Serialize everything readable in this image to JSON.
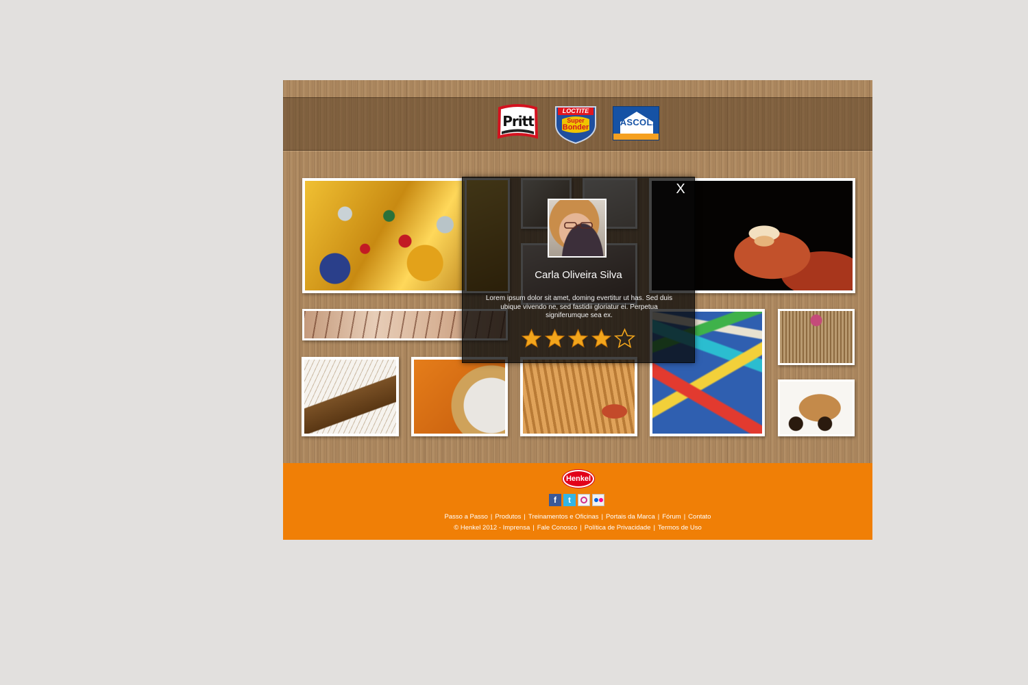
{
  "brands": {
    "pritt": "Pritt",
    "loctite_top": "LOCTITE",
    "loctite_bottom_1": "Super",
    "loctite_bottom_2": "Bonder",
    "cascola": "CASCOLA"
  },
  "gallery": {
    "tiles": [
      "ornament",
      "hand-house",
      "wood-carving",
      "ship-model",
      "mirror",
      "baskets",
      "paper-boats",
      "wicker-chest",
      "wooden-toy"
    ]
  },
  "modal": {
    "close_label": "X",
    "name": "Carla Oliveira Silva",
    "text": "Lorem ipsum dolor sit amet, doming evertitur ut has. Sed duis ubique vivendo ne, sed fastidii gloriatur ei. Perpetua signiferumque sea ex.",
    "rating": {
      "filled": 4,
      "total": 5
    },
    "colors": {
      "star": "#f2a51c"
    }
  },
  "footer": {
    "logo": "Henkel",
    "social": [
      "facebook-icon",
      "twitter-icon",
      "orkut-icon",
      "flickr-icon"
    ],
    "links_row1": [
      "Passo a Passo",
      "Produtos",
      "Treinamentos e Oficinas",
      "Portais da Marca",
      "Fórum",
      "Contato"
    ],
    "links_row2": [
      "© Henkel 2012 - Imprensa",
      "Fale Conosco",
      "Política de Privacidade",
      "Termos de Uso"
    ],
    "colors": {
      "background": "#f07f06"
    }
  }
}
